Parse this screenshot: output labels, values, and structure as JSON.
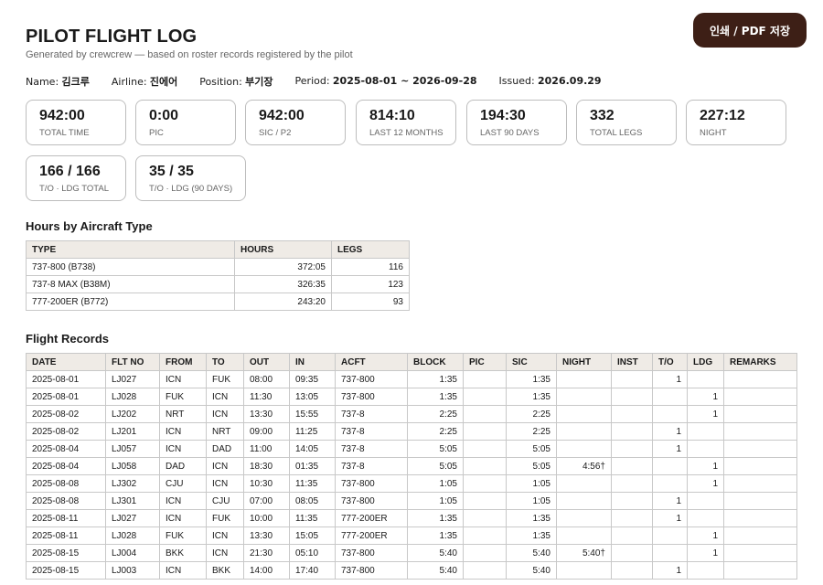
{
  "header": {
    "title": "PILOT FLIGHT LOG",
    "subtitle": "Generated by crewcrew — based on roster records registered by the pilot",
    "print_button": "인쇄 / PDF 저장"
  },
  "meta": {
    "name_label": "Name:",
    "name": "김크루",
    "airline_label": "Airline:",
    "airline": "진에어",
    "position_label": "Position:",
    "position": "부기장",
    "period_label": "Period:",
    "period": "2025-08-01 ~ 2026-09-28",
    "issued_label": "Issued:",
    "issued": "2026.09.29"
  },
  "summary_cards": [
    {
      "value": "942:00",
      "label": "TOTAL TIME"
    },
    {
      "value": "0:00",
      "label": "PIC"
    },
    {
      "value": "942:00",
      "label": "SIC / P2"
    },
    {
      "value": "814:10",
      "label": "LAST 12 MONTHS"
    },
    {
      "value": "194:30",
      "label": "LAST 90 DAYS"
    },
    {
      "value": "332",
      "label": "TOTAL LEGS"
    },
    {
      "value": "227:12",
      "label": "NIGHT"
    },
    {
      "value": "166 / 166",
      "label": "T/O · LDG TOTAL"
    },
    {
      "value": "35 / 35",
      "label": "T/O · LDG (90 DAYS)"
    }
  ],
  "aircraft_section": {
    "title": "Hours by Aircraft Type",
    "headers": [
      "TYPE",
      "HOURS",
      "LEGS"
    ],
    "rows": [
      [
        "737-800 (B738)",
        "372:05",
        "116"
      ],
      [
        "737-8 MAX (B38M)",
        "326:35",
        "123"
      ],
      [
        "777-200ER (B772)",
        "243:20",
        "93"
      ]
    ]
  },
  "records_section": {
    "title": "Flight Records",
    "headers": [
      "DATE",
      "FLT NO",
      "FROM",
      "TO",
      "OUT",
      "IN",
      "ACFT",
      "BLOCK",
      "PIC",
      "SIC",
      "NIGHT",
      "INST",
      "T/O",
      "LDG",
      "REMARKS"
    ],
    "rows": [
      [
        "2025-08-01",
        "LJ027",
        "ICN",
        "FUK",
        "08:00",
        "09:35",
        "737-800",
        "1:35",
        "",
        "1:35",
        "",
        "",
        "1",
        "",
        ""
      ],
      [
        "2025-08-01",
        "LJ028",
        "FUK",
        "ICN",
        "11:30",
        "13:05",
        "737-800",
        "1:35",
        "",
        "1:35",
        "",
        "",
        "",
        "1",
        ""
      ],
      [
        "2025-08-02",
        "LJ202",
        "NRT",
        "ICN",
        "13:30",
        "15:55",
        "737-8",
        "2:25",
        "",
        "2:25",
        "",
        "",
        "",
        "1",
        ""
      ],
      [
        "2025-08-02",
        "LJ201",
        "ICN",
        "NRT",
        "09:00",
        "11:25",
        "737-8",
        "2:25",
        "",
        "2:25",
        "",
        "",
        "1",
        "",
        ""
      ],
      [
        "2025-08-04",
        "LJ057",
        "ICN",
        "DAD",
        "11:00",
        "14:05",
        "737-8",
        "5:05",
        "",
        "5:05",
        "",
        "",
        "1",
        "",
        ""
      ],
      [
        "2025-08-04",
        "LJ058",
        "DAD",
        "ICN",
        "18:30",
        "01:35",
        "737-8",
        "5:05",
        "",
        "5:05",
        "4:56†",
        "",
        "",
        "1",
        ""
      ],
      [
        "2025-08-08",
        "LJ302",
        "CJU",
        "ICN",
        "10:30",
        "11:35",
        "737-800",
        "1:05",
        "",
        "1:05",
        "",
        "",
        "",
        "1",
        ""
      ],
      [
        "2025-08-08",
        "LJ301",
        "ICN",
        "CJU",
        "07:00",
        "08:05",
        "737-800",
        "1:05",
        "",
        "1:05",
        "",
        "",
        "1",
        "",
        ""
      ],
      [
        "2025-08-11",
        "LJ027",
        "ICN",
        "FUK",
        "10:00",
        "11:35",
        "777-200ER",
        "1:35",
        "",
        "1:35",
        "",
        "",
        "1",
        "",
        ""
      ],
      [
        "2025-08-11",
        "LJ028",
        "FUK",
        "ICN",
        "13:30",
        "15:05",
        "777-200ER",
        "1:35",
        "",
        "1:35",
        "",
        "",
        "",
        "1",
        ""
      ],
      [
        "2025-08-15",
        "LJ004",
        "BKK",
        "ICN",
        "21:30",
        "05:10",
        "737-800",
        "5:40",
        "",
        "5:40",
        "5:40†",
        "",
        "",
        "1",
        ""
      ],
      [
        "2025-08-15",
        "LJ003",
        "ICN",
        "BKK",
        "14:00",
        "17:40",
        "737-800",
        "5:40",
        "",
        "5:40",
        "",
        "",
        "1",
        "",
        ""
      ]
    ]
  }
}
